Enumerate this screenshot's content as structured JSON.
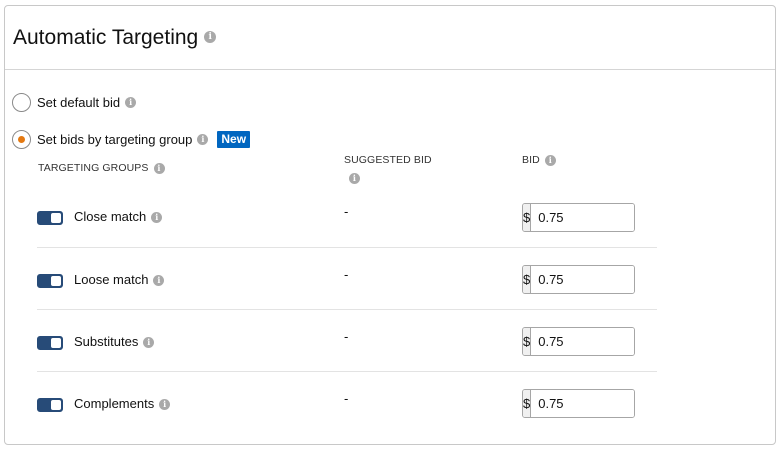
{
  "panel": {
    "title": "Automatic Targeting"
  },
  "bid_options": {
    "default": {
      "label": "Set default bid",
      "selected": false
    },
    "by_group": {
      "label": "Set bids by targeting group",
      "selected": true,
      "badge": "New"
    }
  },
  "columns": {
    "targeting_groups": "TARGETING GROUPS",
    "suggested_bid": "SUGGESTED BID",
    "bid": "BID"
  },
  "groups": [
    {
      "name": "Close match",
      "enabled": true,
      "suggested": "-",
      "currency": "$",
      "bid": "0.75"
    },
    {
      "name": "Loose match",
      "enabled": true,
      "suggested": "-",
      "currency": "$",
      "bid": "0.75"
    },
    {
      "name": "Substitutes",
      "enabled": true,
      "suggested": "-",
      "currency": "$",
      "bid": "0.75"
    },
    {
      "name": "Complements",
      "enabled": true,
      "suggested": "-",
      "currency": "$",
      "bid": "0.75"
    }
  ],
  "colors": {
    "accent_radio": "#e47911",
    "badge": "#0066c0",
    "toggle": "#274b78"
  },
  "icons": {
    "info": "info-icon"
  }
}
